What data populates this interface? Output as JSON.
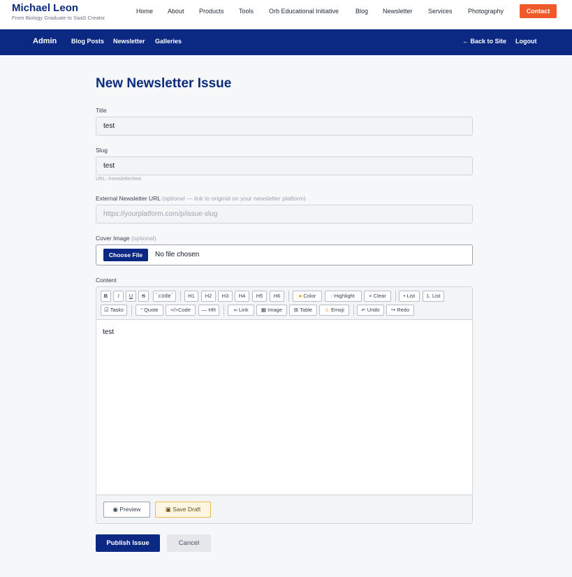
{
  "site": {
    "brand_name": "Michael Leon",
    "brand_tagline": "From Biology Graduate to SaaS Creator",
    "nav": [
      "Home",
      "About",
      "Products",
      "Tools",
      "Orb Educational Initiative",
      "Blog",
      "Newsletter",
      "Services",
      "Photography"
    ],
    "contact_label": "Contact",
    "accent_color": "#f05a28"
  },
  "admin_bar": {
    "title": "Admin",
    "links": [
      "Blog Posts",
      "Newsletter",
      "Galleries"
    ],
    "back_label": "← Back to Site",
    "logout_label": "Logout",
    "color": "#0b2882"
  },
  "form": {
    "heading": "New Newsletter Issue",
    "title": {
      "label": "Title",
      "value": "test"
    },
    "slug": {
      "label": "Slug",
      "value": "test",
      "hint": "URL: /newsletter/test"
    },
    "external_url": {
      "label": "External Newsletter URL",
      "optional_note": "(optional — link to original on your newsletter platform)",
      "placeholder": "https://yourplatform.com/p/issue-slug"
    },
    "cover_image": {
      "label": "Cover Image",
      "optional_note": "(optional)",
      "button_label": "Choose File",
      "status": "No file chosen"
    },
    "content": {
      "label": "Content",
      "toolbar_row1": [
        {
          "icon": "bold-icon",
          "label": "B"
        },
        {
          "icon": "italic-icon",
          "label": "I"
        },
        {
          "icon": "underline-icon",
          "label": "U"
        },
        {
          "icon": "strikethrough-icon",
          "label": "S"
        },
        {
          "icon": "inline-code-icon",
          "label": "`code`"
        },
        {
          "icon": "heading-1-icon",
          "label": "H1"
        },
        {
          "icon": "heading-2-icon",
          "label": "H2"
        },
        {
          "icon": "heading-3-icon",
          "label": "H3"
        },
        {
          "icon": "heading-4-icon",
          "label": "H4"
        },
        {
          "icon": "heading-5-icon",
          "label": "H5"
        },
        {
          "icon": "heading-6-icon",
          "label": "H6"
        },
        {
          "icon": "palette-icon",
          "label": "Color"
        },
        {
          "icon": "highlighter-icon",
          "label": "Highlight"
        },
        {
          "icon": "clear-format-icon",
          "label": "Clear"
        },
        {
          "icon": "bullet-list-icon",
          "label": "List"
        },
        {
          "icon": "numbered-list-icon",
          "label": "1. List"
        }
      ],
      "toolbar_row2": [
        {
          "icon": "checkbox-icon",
          "label": "Tasks"
        },
        {
          "icon": "quote-icon",
          "label": "Quote"
        },
        {
          "icon": "code-block-icon",
          "label": "Code"
        },
        {
          "icon": "horizontal-rule-icon",
          "label": "HR"
        },
        {
          "icon": "link-icon",
          "label": "Link"
        },
        {
          "icon": "image-icon",
          "label": "Image"
        },
        {
          "icon": "table-icon",
          "label": "Table"
        },
        {
          "icon": "emoji-icon",
          "label": "Emoji"
        },
        {
          "icon": "undo-icon",
          "label": "Undo"
        },
        {
          "icon": "redo-icon",
          "label": "Redo"
        }
      ],
      "body": "test",
      "preview_label": "Preview",
      "save_draft_label": "Save Draft"
    },
    "publish_label": "Publish Issue",
    "cancel_label": "Cancel"
  }
}
